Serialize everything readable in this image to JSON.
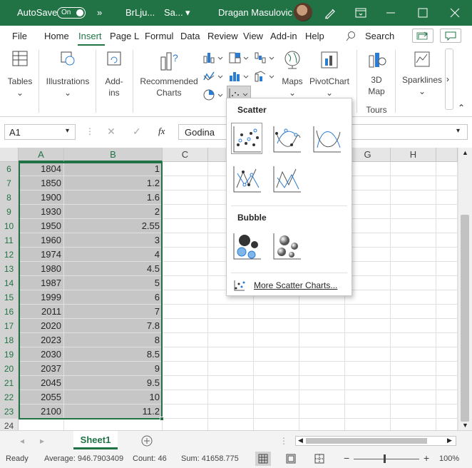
{
  "titlebar": {
    "autosave_label": "AutoSave",
    "autosave_state": "On",
    "more": "»",
    "doc_name": "BrLju...",
    "save_state": "Sa...",
    "user_name": "Dragan Masulovic",
    "accent": "#217346"
  },
  "menu": {
    "tabs": [
      "File",
      "Home",
      "Insert",
      "Page L",
      "Formul",
      "Data",
      "Review",
      "View",
      "Add-in",
      "Help"
    ],
    "active_tab": "Insert",
    "search": "Search"
  },
  "ribbon": {
    "tables": "Tables",
    "illustrations": "Illustrations",
    "addins": "Add-\nins",
    "recommended_charts": "Recommended\nCharts",
    "maps": "Maps",
    "pivotchart": "PivotChart",
    "map3d": "3D\nMap",
    "sparklines": "Sparklines",
    "tours_group": "Tours"
  },
  "formula_bar": {
    "name_box": "A1",
    "content": "Godina"
  },
  "grid": {
    "columns": [
      "A",
      "B",
      "C",
      "D",
      "E",
      "F",
      "G",
      "H"
    ],
    "rows": [
      {
        "n": "6",
        "a": "1804",
        "b": "1"
      },
      {
        "n": "7",
        "a": "1850",
        "b": "1.2"
      },
      {
        "n": "8",
        "a": "1900",
        "b": "1.6"
      },
      {
        "n": "9",
        "a": "1930",
        "b": "2"
      },
      {
        "n": "10",
        "a": "1950",
        "b": "2.55"
      },
      {
        "n": "11",
        "a": "1960",
        "b": "3"
      },
      {
        "n": "12",
        "a": "1974",
        "b": "4"
      },
      {
        "n": "13",
        "a": "1980",
        "b": "4.5"
      },
      {
        "n": "14",
        "a": "1987",
        "b": "5"
      },
      {
        "n": "15",
        "a": "1999",
        "b": "6"
      },
      {
        "n": "16",
        "a": "2011",
        "b": "7"
      },
      {
        "n": "17",
        "a": "2020",
        "b": "7.8"
      },
      {
        "n": "18",
        "a": "2023",
        "b": "8"
      },
      {
        "n": "19",
        "a": "2030",
        "b": "8.5"
      },
      {
        "n": "20",
        "a": "2037",
        "b": "9"
      },
      {
        "n": "21",
        "a": "2045",
        "b": "9.5"
      },
      {
        "n": "22",
        "a": "2055",
        "b": "10"
      },
      {
        "n": "23",
        "a": "2100",
        "b": "11.2"
      },
      {
        "n": "24",
        "a": "",
        "b": ""
      }
    ]
  },
  "dropdown": {
    "scatter_header": "Scatter",
    "bubble_header": "Bubble",
    "more_link": "More Scatter Charts..."
  },
  "sheets": {
    "active": "Sheet1"
  },
  "status": {
    "ready": "Ready",
    "average": "Average: 946.7903409",
    "count": "Count: 46",
    "sum": "Sum: 41658.775",
    "zoom": "100%"
  }
}
